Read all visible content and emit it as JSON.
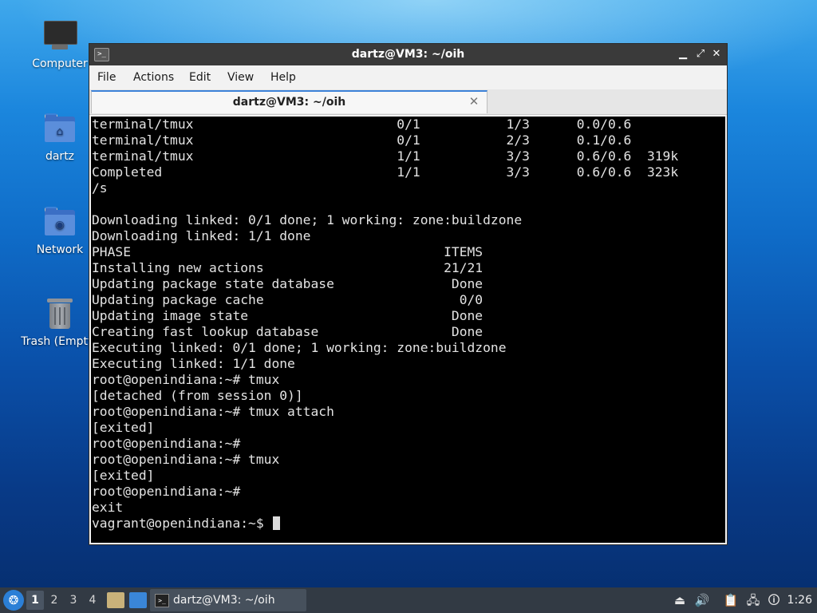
{
  "desktop": {
    "icons": [
      {
        "label": "Computer",
        "icon": "computer-icon"
      },
      {
        "label": "dartz",
        "icon": "home-folder-icon"
      },
      {
        "label": "Network",
        "icon": "network-folder-icon"
      },
      {
        "label": "Trash (Empty)",
        "icon": "trash-icon"
      }
    ]
  },
  "window": {
    "title": "dartz@VM3: ~/oih",
    "menu": [
      "File",
      "Actions",
      "Edit",
      "View",
      "Help"
    ],
    "tab_label": "dartz@VM3: ~/oih",
    "tab_close_glyph": "✕",
    "controls": {
      "minimize": "▁",
      "maximize": "⤢",
      "close": "✕"
    }
  },
  "terminal": {
    "lines": [
      "terminal/tmux                          0/1           1/3      0.0/0.6",
      "terminal/tmux                          0/1           2/3      0.1/0.6",
      "terminal/tmux                          1/1           3/3      0.6/0.6  319k",
      "Completed                              1/1           3/3      0.6/0.6  323k",
      "/s",
      "",
      "Downloading linked: 0/1 done; 1 working: zone:buildzone",
      "Downloading linked: 1/1 done",
      "PHASE                                        ITEMS",
      "Installing new actions                       21/21",
      "Updating package state database               Done",
      "Updating package cache                         0/0",
      "Updating image state                          Done",
      "Creating fast lookup database                 Done",
      "Executing linked: 0/1 done; 1 working: zone:buildzone",
      "Executing linked: 1/1 done",
      "root@openindiana:~# tmux",
      "[detached (from session 0)]",
      "root@openindiana:~# tmux attach",
      "[exited]",
      "root@openindiana:~#",
      "root@openindiana:~# tmux",
      "[exited]",
      "root@openindiana:~#",
      "exit",
      "vagrant@openindiana:~$ "
    ]
  },
  "taskbar": {
    "workspaces": [
      "1",
      "2",
      "3",
      "4"
    ],
    "active_workspace": "1",
    "task_label": "dartz@VM3: ~/oih",
    "clock": "1:26",
    "tray_icons": [
      "eject-icon",
      "volume-icon",
      "clipboard-icon",
      "network-icon",
      "notification-icon"
    ]
  }
}
